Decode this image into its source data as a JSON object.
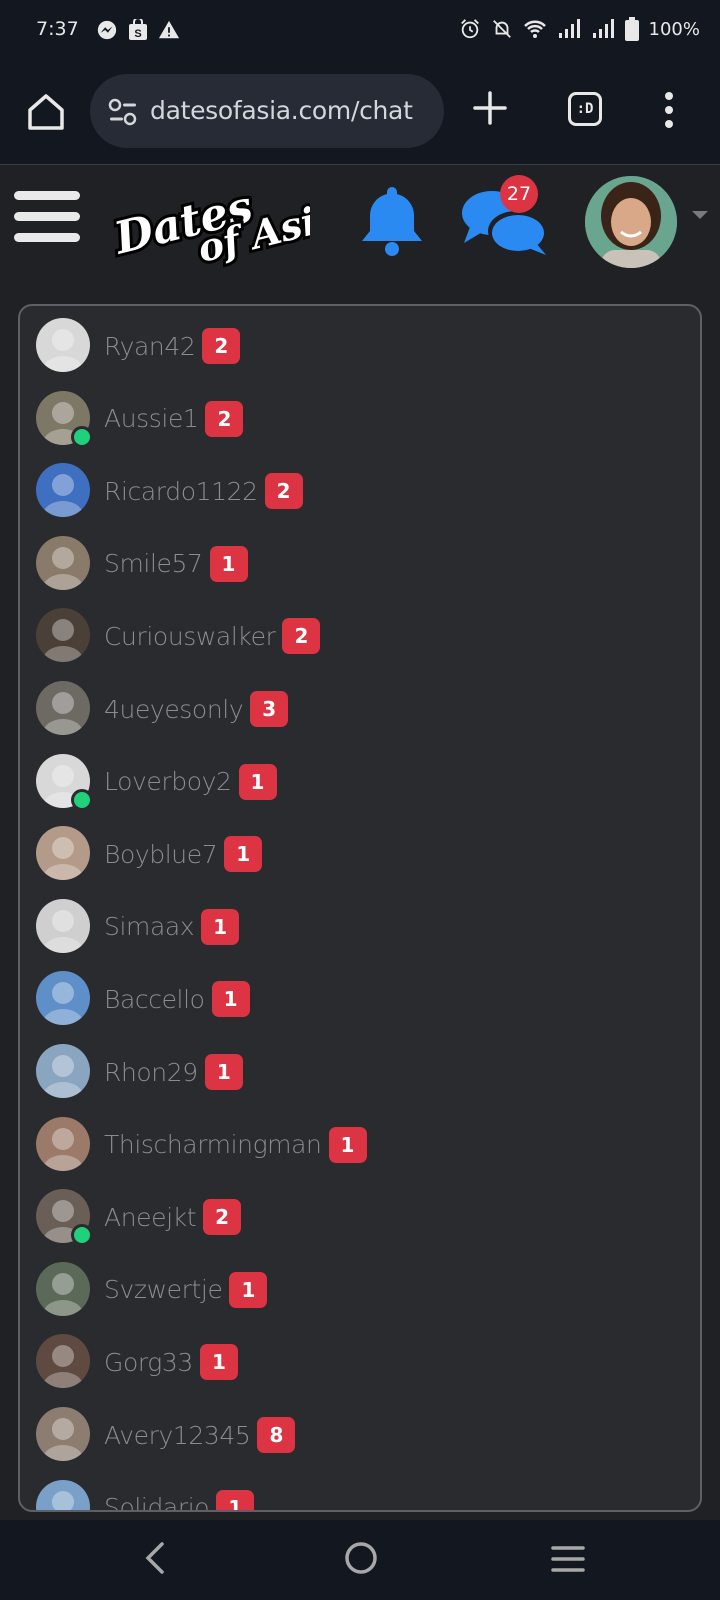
{
  "status": {
    "time": "7:37",
    "battery": "100%"
  },
  "browser": {
    "url": "datesofasia.com/chat",
    "tabs_label": ":D"
  },
  "header": {
    "logo_line1": "Dates",
    "logo_line2": "of Asia",
    "message_count": "27"
  },
  "colors": {
    "accent_blue": "#2b8af2",
    "badge_red": "#dd3444",
    "online_green": "#21d07a"
  },
  "chats": [
    {
      "name": "Ryan42",
      "count": "2",
      "online": false,
      "avatar_color": "#d8d8d8"
    },
    {
      "name": "Aussie1",
      "count": "2",
      "online": true,
      "avatar_color": "#7d7766"
    },
    {
      "name": "Ricardo1122",
      "count": "2",
      "online": false,
      "avatar_color": "#3f6fc0"
    },
    {
      "name": "Smile57",
      "count": "1",
      "online": false,
      "avatar_color": "#8a7a6a"
    },
    {
      "name": "Curiouswalker",
      "count": "2",
      "online": false,
      "avatar_color": "#4a4038"
    },
    {
      "name": "4ueyesonly",
      "count": "3",
      "online": false,
      "avatar_color": "#6d6a64"
    },
    {
      "name": "Loverboy2",
      "count": "1",
      "online": true,
      "avatar_color": "#d8d8d8"
    },
    {
      "name": "Boyblue7",
      "count": "1",
      "online": false,
      "avatar_color": "#b49a88"
    },
    {
      "name": "Simaax",
      "count": "1",
      "online": false,
      "avatar_color": "#cfcfcf"
    },
    {
      "name": "Baccello",
      "count": "1",
      "online": false,
      "avatar_color": "#5f8fc8"
    },
    {
      "name": "Rhon29",
      "count": "1",
      "online": false,
      "avatar_color": "#8aa5c0"
    },
    {
      "name": "Thischarmingman",
      "count": "1",
      "online": false,
      "avatar_color": "#9b7a6a"
    },
    {
      "name": "Aneejkt",
      "count": "2",
      "online": true,
      "avatar_color": "#6a5f56"
    },
    {
      "name": "Svzwertje",
      "count": "1",
      "online": false,
      "avatar_color": "#5b6a58"
    },
    {
      "name": "Gorg33",
      "count": "1",
      "online": false,
      "avatar_color": "#5e4a40"
    },
    {
      "name": "Avery12345",
      "count": "8",
      "online": false,
      "avatar_color": "#8d7d70"
    },
    {
      "name": "Solidario",
      "count": "1",
      "online": false,
      "avatar_color": "#7aa0c8"
    }
  ]
}
